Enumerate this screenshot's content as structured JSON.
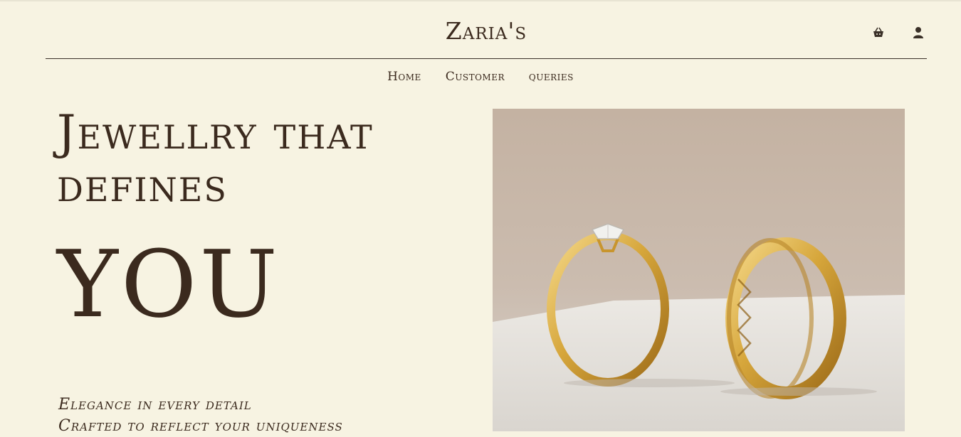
{
  "header": {
    "brand": "Zaria's",
    "icons": [
      "basket-icon",
      "user-icon"
    ]
  },
  "nav": {
    "items": [
      {
        "label": "Home"
      },
      {
        "label": "Customer"
      },
      {
        "label": "queries"
      }
    ]
  },
  "hero": {
    "title_line1": "Jewellry that",
    "title_line2": "defines",
    "title_emphasis": "YOU",
    "tagline_line1": "Elegance in every detail",
    "tagline_line2": "Crafted to reflect your uniqueness"
  },
  "colors": {
    "background": "#f7f3e2",
    "text": "#3b2a1e",
    "gold": "#d6a63b"
  }
}
